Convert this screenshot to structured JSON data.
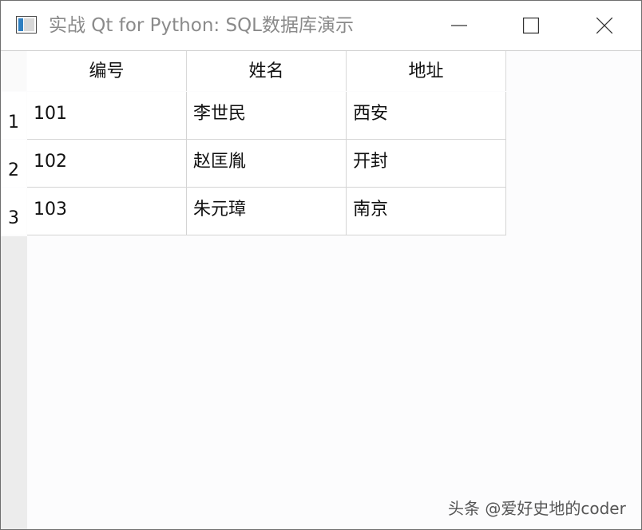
{
  "window": {
    "title": "实战 Qt for Python: SQL数据库演示"
  },
  "table": {
    "columns": [
      "编号",
      "姓名",
      "地址"
    ],
    "row_headers": [
      "1",
      "2",
      "3"
    ],
    "rows": [
      [
        "101",
        "李世民",
        "西安"
      ],
      [
        "102",
        "赵匡胤",
        "开封"
      ],
      [
        "103",
        "朱元璋",
        "南京"
      ]
    ]
  },
  "watermark": "头条 @爱好史地的coder",
  "icons": {
    "app": "qt-window-icon",
    "minimize": "minimize-icon",
    "maximize": "maximize-icon",
    "close": "close-icon"
  }
}
